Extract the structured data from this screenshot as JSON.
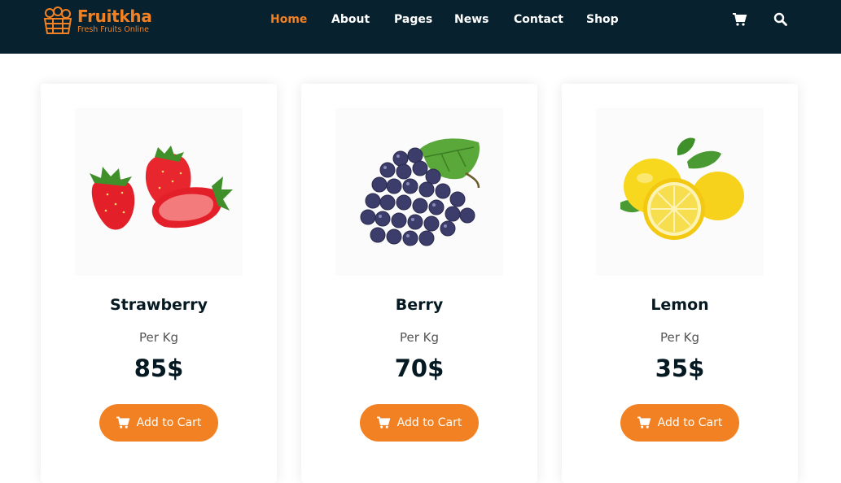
{
  "header": {
    "logo_title": "Fruitkha",
    "logo_subtitle": "Fresh Fruits Online",
    "nav": [
      {
        "label": "Home",
        "active": true
      },
      {
        "label": "About",
        "active": false
      },
      {
        "label": "Pages",
        "active": false
      },
      {
        "label": "News",
        "active": false
      },
      {
        "label": "Contact",
        "active": false
      },
      {
        "label": "Shop",
        "active": false
      }
    ],
    "icons": [
      "shopping-cart-icon",
      "search-icon"
    ]
  },
  "products": [
    {
      "name": "Strawberry",
      "unit": "Per Kg",
      "price": "85$",
      "button": "Add to Cart",
      "image": "strawberry"
    },
    {
      "name": "Berry",
      "unit": "Per Kg",
      "price": "70$",
      "button": "Add to Cart",
      "image": "grapes"
    },
    {
      "name": "Lemon",
      "unit": "Per Kg",
      "price": "35$",
      "button": "Add to Cart",
      "image": "lemon"
    }
  ],
  "colors": {
    "navbar": "#07212e",
    "accent": "#f28123",
    "text_dark": "#051922",
    "text_muted": "#555555"
  }
}
